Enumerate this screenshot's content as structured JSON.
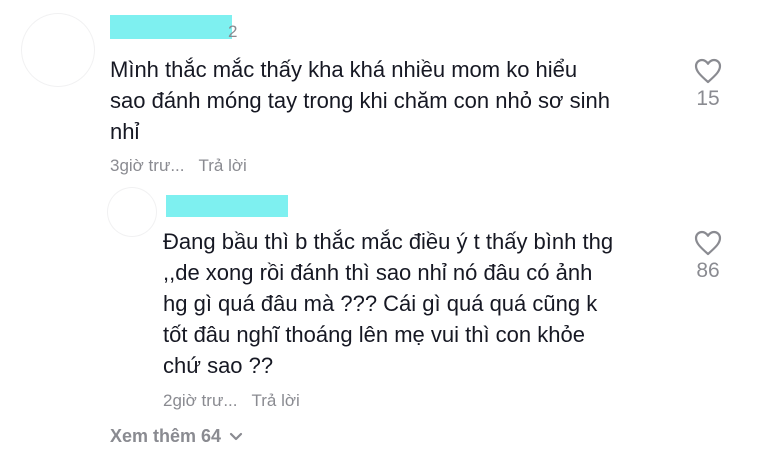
{
  "comments": [
    {
      "text_lines": [
        "Mình thắc mắc thấy kha khá nhiều mom ko hiểu",
        "sao đánh móng tay trong khi chăm con nhỏ sơ sinh",
        "nhỉ"
      ],
      "time": "3giờ trư...",
      "reply_label": "Trả lời",
      "like_count": "15",
      "username_redacted": true,
      "like_icon": "heart-outline-icon"
    },
    {
      "text_lines": [
        "Đang bầu thì b thắc mắc điều ý t thấy bình thg",
        ",,de xong rồi đánh thì sao nhỉ nó đâu có ảnh",
        "hg gì quá đâu mà ??? Cái gì quá quá cũng k",
        "tốt đâu nghĩ thoáng lên mẹ vui thì con khỏe",
        "chứ sao ??"
      ],
      "time": "2giờ trư...",
      "reply_label": "Trả lời",
      "like_count": "86",
      "username_redacted": true,
      "like_icon": "heart-outline-icon"
    }
  ],
  "view_more": {
    "label": "Xem thêm 64",
    "icon": "chevron-down-icon"
  },
  "colors": {
    "text": "#161823",
    "muted": "#8a8b91",
    "redaction": "#7ef0f0"
  }
}
